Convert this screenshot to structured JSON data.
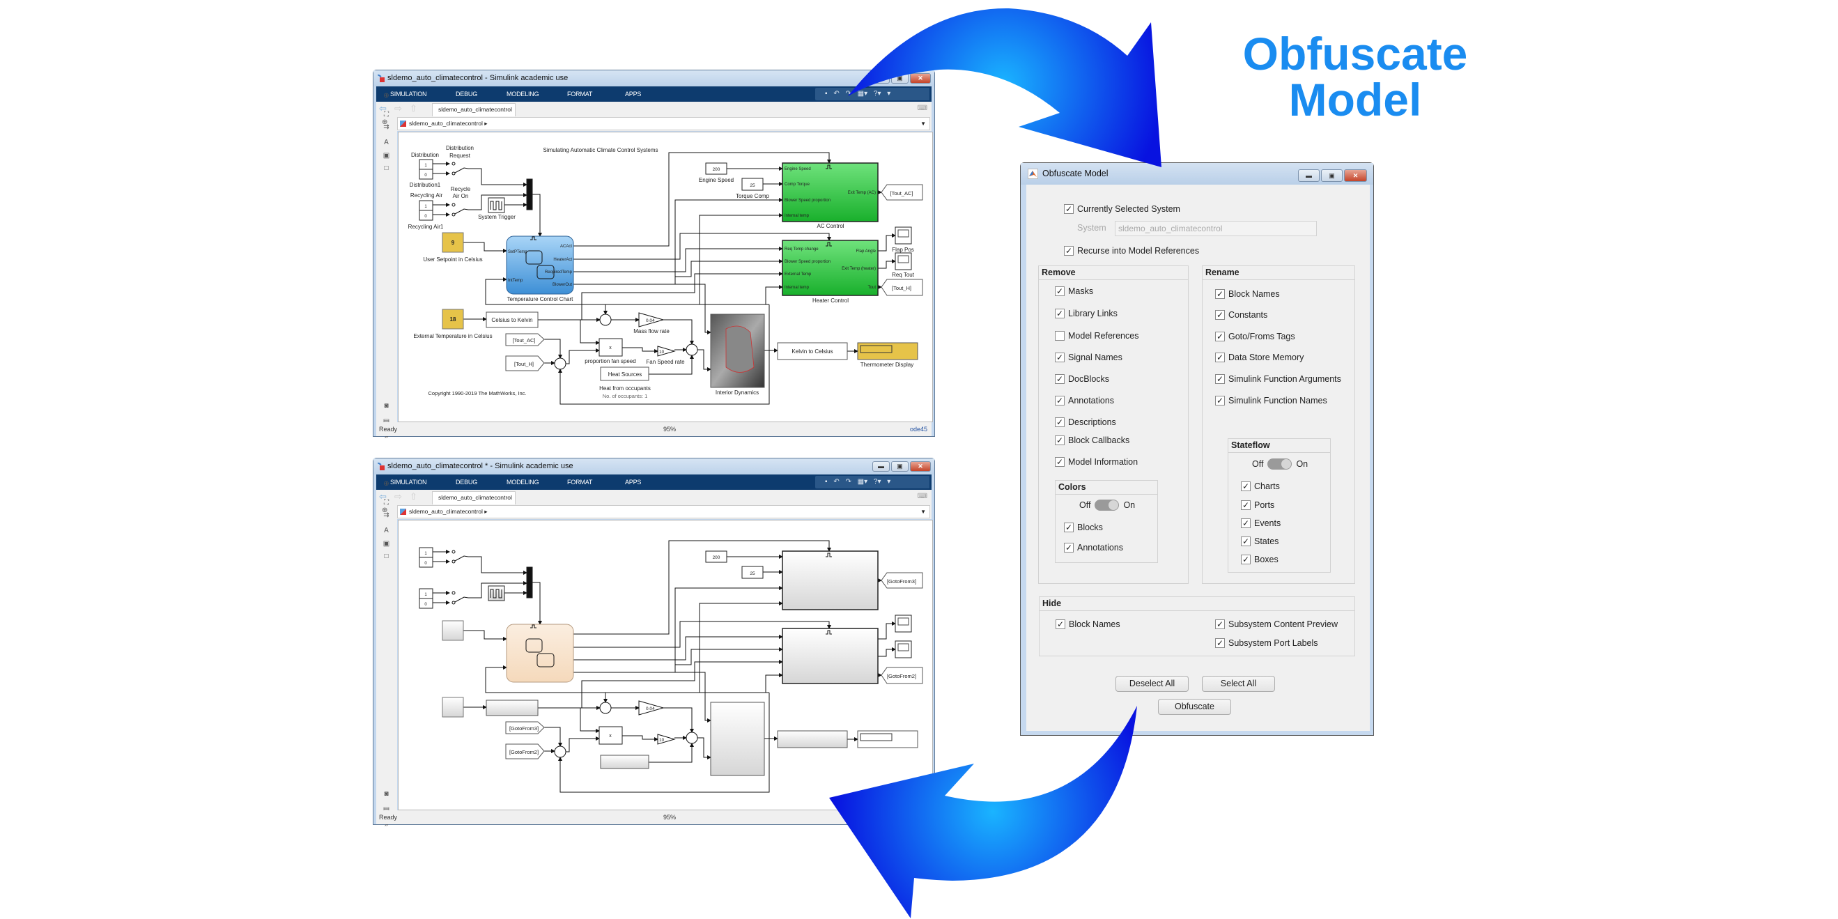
{
  "headline": {
    "line1": "Obfuscate",
    "line2": "Model",
    "color": "#1a8cf0"
  },
  "arrow_colors": {
    "center": "#1ab4ff",
    "edge": "#0812e0"
  },
  "windows": [
    {
      "title": "sldemo_auto_climatecontrol - Simulink academic use",
      "ribbon_tabs": [
        "SIMULATION",
        "DEBUG",
        "MODELING",
        "FORMAT",
        "APPS"
      ],
      "doc_tab": "sldemo_auto_climatecontrol",
      "breadcrumb": "sldemo_auto_climatecontrol",
      "status": {
        "left": "Ready",
        "zoom": "95%",
        "solver": "ode45"
      },
      "diagram": {
        "annotation_title": "Simulating Automatic Climate Control Systems",
        "copyright": "Copyright 1990-2019 The MathWorks, Inc.",
        "const_1": "1",
        "const_0": "0",
        "distribution": "Distribution",
        "distribution1": "Distribution1",
        "distribution_request_1": "Distribution",
        "distribution_request_2": "Request",
        "recycling_air": "Recycling Air",
        "recycling_air1": "Recycling Air1",
        "recycle_air_on_1": "Recycle",
        "recycle_air_on_2": "Air On",
        "system_trigger": "System Trigger",
        "user_setpoint_value": "9",
        "user_setpoint": "User Setpoint in Celsius",
        "external_temp_value": "18",
        "external_temp": "External Temperature in Celsius",
        "chart_name": "Temperature Control Chart",
        "chart_ports": {
          "in1": "SetPTemp",
          "in2": "IntTemp",
          "out1": "ACAct",
          "out2": "HeaterAct",
          "out3": "RequiredTemp",
          "out4": "BlowerOut"
        },
        "engine_speed_value": "200",
        "engine_speed": "Engine Speed",
        "torque_value": "25",
        "torque_comp": "Torque Comp",
        "ac_control": "AC Control",
        "ac_ports": {
          "in1": "Engine Speed",
          "in2": "Comp Torque",
          "in3": "Blower Speed proportion",
          "in4": "Internal temp",
          "out1": "Exit Temp (AC)"
        },
        "heater_control": "Heater Control",
        "heater_ports": {
          "in1": "Req Temp change",
          "in2": "Blower Speed proportion",
          "in3": "External Temp",
          "in4": "Internal temp",
          "out1": "Flap Angle",
          "out2": "Exit Temp (heater)",
          "out3": "Tout"
        },
        "goto_ac": "[Tout_AC]",
        "goto_h": "[Tout_H]",
        "flap_pos": "Flap Pos",
        "req_tout": "Req Tout",
        "celsius_to_kelvin": "Celsius to Kelvin",
        "gain_mass_value": "0.04",
        "mass_flow_rate": "Mass flow rate",
        "from_ac": "[Tout_AC]",
        "from_h": "[Tout_H]",
        "product_symbol": "x",
        "proportion_fan_speed": "proportion fan speed",
        "gain_fan_value": "10",
        "fan_speed_rate": "Fan Speed rate",
        "heat_sources": "Heat Sources",
        "heat_from_occupants": "Heat from occupants",
        "occupants": "No. of occupants: 1",
        "interior_dynamics": "Interior Dynamics",
        "kelvin_to_celsius": "Kelvin to Celsius",
        "thermometer_display": "Thermometer Display"
      }
    },
    {
      "title": "sldemo_auto_climatecontrol * - Simulink academic use",
      "ribbon_tabs": [
        "SIMULATION",
        "DEBUG",
        "MODELING",
        "FORMAT",
        "APPS"
      ],
      "doc_tab": "sldemo_auto_climatecontrol",
      "breadcrumb": "sldemo_auto_climatecontrol",
      "status": {
        "left": "Ready",
        "zoom": "95%"
      },
      "diagram": {
        "const_1": "1",
        "const_0": "0",
        "engine_speed_value": "200",
        "torque_value": "25",
        "gain_mass_value": "0.04",
        "gain_fan_value": "10",
        "product_symbol": "x",
        "goto_ac": "[GotoFrom3]",
        "goto_h": "[GotoFrom2]",
        "from_ac": "[GotoFrom3]",
        "from_h": "[GotoFrom2]"
      }
    }
  ],
  "dialog": {
    "title": "Obfuscate Model",
    "currently_selected_system": {
      "label": "Currently Selected System",
      "checked": true
    },
    "system_label": "System",
    "system_value": "sldemo_auto_climatecontrol",
    "recurse": {
      "label": "Recurse into Model References",
      "checked": true
    },
    "remove": {
      "header": "Remove",
      "items": [
        {
          "label": "Masks",
          "checked": true
        },
        {
          "label": "Library Links",
          "checked": true
        },
        {
          "label": "Model References",
          "checked": false
        },
        {
          "label": "Signal Names",
          "checked": true
        },
        {
          "label": "DocBlocks",
          "checked": true
        },
        {
          "label": "Annotations",
          "checked": true
        },
        {
          "label": "Descriptions",
          "checked": true
        },
        {
          "label": "Block Callbacks",
          "checked": true
        },
        {
          "label": "Model Information",
          "checked": true
        }
      ],
      "colors": {
        "header": "Colors",
        "toggle_off": "Off",
        "toggle_on": "On",
        "toggle_state": "on",
        "items": [
          {
            "label": "Blocks",
            "checked": true
          },
          {
            "label": "Annotations",
            "checked": true
          }
        ]
      }
    },
    "rename": {
      "header": "Rename",
      "items": [
        {
          "label": "Block Names",
          "checked": true
        },
        {
          "label": "Constants",
          "checked": true
        },
        {
          "label": "Goto/Froms Tags",
          "checked": true
        },
        {
          "label": "Data Store Memory",
          "checked": true
        },
        {
          "label": "Simulink Function Arguments",
          "checked": true
        },
        {
          "label": "Simulink Function Names",
          "checked": true
        }
      ],
      "stateflow": {
        "header": "Stateflow",
        "toggle_off": "Off",
        "toggle_on": "On",
        "toggle_state": "on",
        "items": [
          {
            "label": "Charts",
            "checked": true
          },
          {
            "label": "Ports",
            "checked": true
          },
          {
            "label": "Events",
            "checked": true
          },
          {
            "label": "States",
            "checked": true
          },
          {
            "label": "Boxes",
            "checked": true
          }
        ]
      }
    },
    "hide": {
      "header": "Hide",
      "items": [
        {
          "label": "Block Names",
          "checked": true
        },
        {
          "label": "Subsystem Content Preview",
          "checked": true
        },
        {
          "label": "Subsystem Port Labels",
          "checked": true
        }
      ]
    },
    "buttons": {
      "deselect_all": "Deselect All",
      "select_all": "Select All",
      "obfuscate": "Obfuscate"
    }
  }
}
